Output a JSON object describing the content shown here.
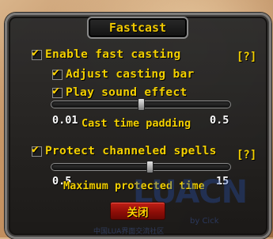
{
  "window": {
    "title": "Fastcast",
    "close_label": "关闭"
  },
  "options": {
    "enable_fast_casting": {
      "label": "Enable fast casting",
      "checked": true
    },
    "adjust_casting_bar": {
      "label": "Adjust casting bar",
      "checked": true
    },
    "play_sound_effect": {
      "label": "Play sound effect",
      "checked": true
    },
    "protect_channeled": {
      "label": "Protect channeled spells",
      "checked": true
    }
  },
  "help": {
    "label": "[?]"
  },
  "sliders": {
    "cast_time_padding": {
      "label": "Cast time padding",
      "min_label": "0.01",
      "max_label": "0.5",
      "fraction": 0.5
    },
    "max_protected_time": {
      "label": "Maximum protected time",
      "min_label": "0.5",
      "max_label": "15",
      "fraction": 0.55
    }
  },
  "watermark": {
    "logo": "LUACN",
    "sub": "by Cick",
    "prefix": "LUA",
    "small": "中国LUA界面交流社区"
  },
  "colors": {
    "label": "#f3d000",
    "value": "#ffffff",
    "close_button": "#a5160e"
  }
}
